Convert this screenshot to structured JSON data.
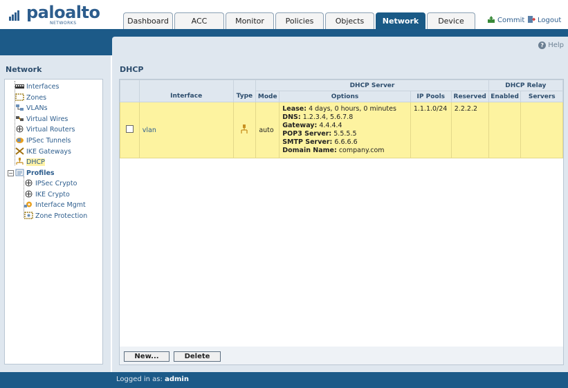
{
  "brand": {
    "name": "paloalto",
    "sub": "NETWORKS"
  },
  "tabs": [
    {
      "label": "Dashboard"
    },
    {
      "label": "ACC"
    },
    {
      "label": "Monitor"
    },
    {
      "label": "Policies"
    },
    {
      "label": "Objects"
    },
    {
      "label": "Network",
      "active": true
    },
    {
      "label": "Device"
    }
  ],
  "top_actions": {
    "commit": "Commit",
    "logout": "Logout"
  },
  "help": "Help",
  "sidebar": {
    "title": "Network",
    "items": [
      {
        "label": "Interfaces",
        "icon": "interfaces-icon"
      },
      {
        "label": "Zones",
        "icon": "zones-icon"
      },
      {
        "label": "VLANs",
        "icon": "vlans-icon"
      },
      {
        "label": "Virtual Wires",
        "icon": "virtual-wires-icon"
      },
      {
        "label": "Virtual Routers",
        "icon": "virtual-routers-icon"
      },
      {
        "label": "IPSec Tunnels",
        "icon": "ipsec-tunnels-icon"
      },
      {
        "label": "IKE Gateways",
        "icon": "ike-gateways-icon"
      },
      {
        "label": "DHCP",
        "icon": "dhcp-icon",
        "selected": true
      },
      {
        "label": "Profiles",
        "icon": "profiles-icon",
        "group": true
      },
      {
        "label": "IPSec Crypto",
        "icon": "ipsec-crypto-icon"
      },
      {
        "label": "IKE Crypto",
        "icon": "ike-crypto-icon"
      },
      {
        "label": "Interface Mgmt",
        "icon": "interface-mgmt-icon"
      },
      {
        "label": "Zone Protection",
        "icon": "zone-protection-icon"
      }
    ]
  },
  "main": {
    "title": "DHCP",
    "headers": {
      "group_server": "DHCP Server",
      "group_relay": "DHCP Relay",
      "interface": "Interface",
      "type": "Type",
      "mode": "Mode",
      "options": "Options",
      "ip_pools": "IP Pools",
      "reserved": "Reserved",
      "enabled": "Enabled",
      "servers": "Servers"
    },
    "rows": [
      {
        "interface": "vlan",
        "mode": "auto",
        "options": [
          {
            "key": "Lease:",
            "value": "4 days, 0 hours, 0 minutes"
          },
          {
            "key": "DNS:",
            "value": "1.2.3.4, 5.6.7.8"
          },
          {
            "key": "Gateway:",
            "value": "4.4.4.4"
          },
          {
            "key": "POP3 Server:",
            "value": "5.5.5.5"
          },
          {
            "key": "SMTP Server:",
            "value": "6.6.6.6"
          },
          {
            "key": "Domain Name:",
            "value": "company.com"
          }
        ],
        "ip_pools": "1.1.1.0/24",
        "reserved": "2.2.2.2",
        "enabled": "",
        "servers": ""
      }
    ],
    "buttons": {
      "new": "New...",
      "delete": "Delete"
    }
  },
  "footer": {
    "prefix": "Logged in as: ",
    "user": "admin"
  },
  "colors": {
    "brand_blue": "#1c5a88",
    "panel_bg": "#dfe7ef",
    "row_highlight": "#fdf3a0"
  }
}
